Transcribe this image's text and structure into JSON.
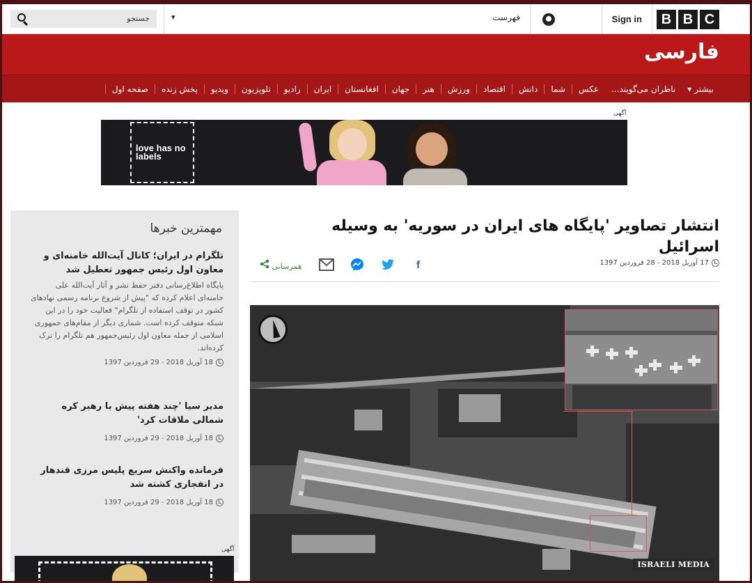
{
  "header": {
    "logo_letters": [
      "B",
      "B",
      "C"
    ],
    "sign_in": "Sign in",
    "menu_label": "فهرست",
    "search_placeholder": "جستجو",
    "dropdown_glyph": "▾"
  },
  "brand": {
    "title": "فارسی"
  },
  "nav": {
    "items": [
      "صفحه اول",
      "پخش زنده",
      "ویدیو",
      "تلویزیون",
      "رادیو",
      "ایران",
      "افغانستان",
      "جهان",
      "هنر",
      "ورزش",
      "اقتصاد",
      "دانش",
      "شما",
      "عکس",
      "ناظران می‌گویند..."
    ],
    "more": "بیشتر ▾"
  },
  "ads": {
    "label": "آگهی",
    "banner_text": "love has no labels"
  },
  "article": {
    "headline": "انتشار تصاویر 'پایگاه های ایران در سوریه' به وسیله اسرائیل",
    "date": "17 آوریل 2018 - 28 فروردین 1397",
    "share_label": "همرسانی",
    "image_watermark": "ISRAELI MEDIA"
  },
  "sidebar": {
    "heading": "مهمترین خبرها",
    "stories": [
      {
        "title": "تلگرام در ایران؛ کانال آیت‌الله خامنه‌ای و معاون اول رئیس جمهور تعطیل شد",
        "summary": "پایگاه اطلاع‌رسانی دفتر حفظ نشر و آثار آیت‌الله علی خامنه‌ای اعلام کرده که \"پیش از شروع برنامه رسمی نهادهای کشور در توقف استفاده از تلگرام\" فعالیت خود را در این شبکه متوقف کرده است. شماری دیگر از مقام‌های جمهوری اسلامی از جمله معاون اول رئیس‌جمهور هم تلگرام را ترک کرده‌اند.",
        "date": "18 آوریل 2018 - 29 فروردین 1397"
      },
      {
        "title": "مدیر سیا 'چند هفته پیش با رهبر کره شمالی ملاقات کرد'",
        "summary": "",
        "date": "18 آوریل 2018 - 29 فروردین 1397"
      },
      {
        "title": "فرمانده واکنش سریع پلیس مرزی قندهار در انفجاری کشته شد",
        "summary": "",
        "date": "18 آوریل 2018 - 29 فروردین 1397"
      }
    ]
  },
  "colors": {
    "brand_red": "#bb1919",
    "nav_red": "#a51717",
    "share_green": "#3a8a3a",
    "facebook": "#3b5998",
    "twitter": "#1da1f2",
    "messenger": "#0084ff"
  }
}
